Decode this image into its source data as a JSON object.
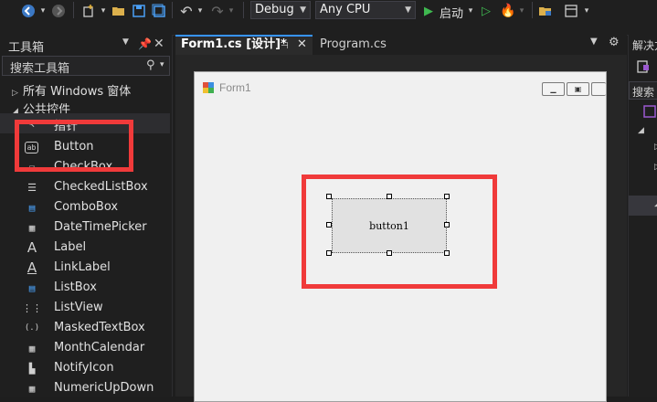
{
  "toolbar": {
    "back_icon": "back-arrow-circle-icon",
    "forward_icon": "forward-arrow-circle-icon",
    "config": "Debug",
    "platform": "Any CPU",
    "start_label": "启动"
  },
  "toolbox": {
    "title": "工具箱",
    "search_label": "搜索工具箱",
    "group_all": "所有 Windows 窗体",
    "group_common": "公共控件",
    "items": [
      {
        "icon": "↖",
        "label": "指针"
      },
      {
        "icon": "ab",
        "label": "Button"
      },
      {
        "icon": "☑",
        "label": "CheckBox"
      },
      {
        "icon": "☰",
        "label": "CheckedListBox"
      },
      {
        "icon": "▤",
        "label": "ComboBox"
      },
      {
        "icon": "▦",
        "label": "DateTimePicker"
      },
      {
        "icon": "A",
        "label": "Label"
      },
      {
        "icon": "A",
        "label": "LinkLabel"
      },
      {
        "icon": "▤",
        "label": "ListBox"
      },
      {
        "icon": "⋮⋮",
        "label": "ListView"
      },
      {
        "icon": "(.)",
        "label": "MaskedTextBox"
      },
      {
        "icon": "▦",
        "label": "MonthCalendar"
      },
      {
        "icon": "▙",
        "label": "NotifyIcon"
      },
      {
        "icon": "▦",
        "label": "NumericUpDown"
      }
    ]
  },
  "editor": {
    "tabs": [
      {
        "label": "Form1.cs [设计]*",
        "active": true
      },
      {
        "label": "Program.cs",
        "active": false
      }
    ]
  },
  "form": {
    "title": "Form1",
    "button_text": "button1"
  },
  "solution": {
    "title": "解决方",
    "search": "搜索"
  },
  "colors": {
    "accent": "#f03a3a",
    "play_green": "#3fb950",
    "ide_bg": "#1e1e1e"
  }
}
